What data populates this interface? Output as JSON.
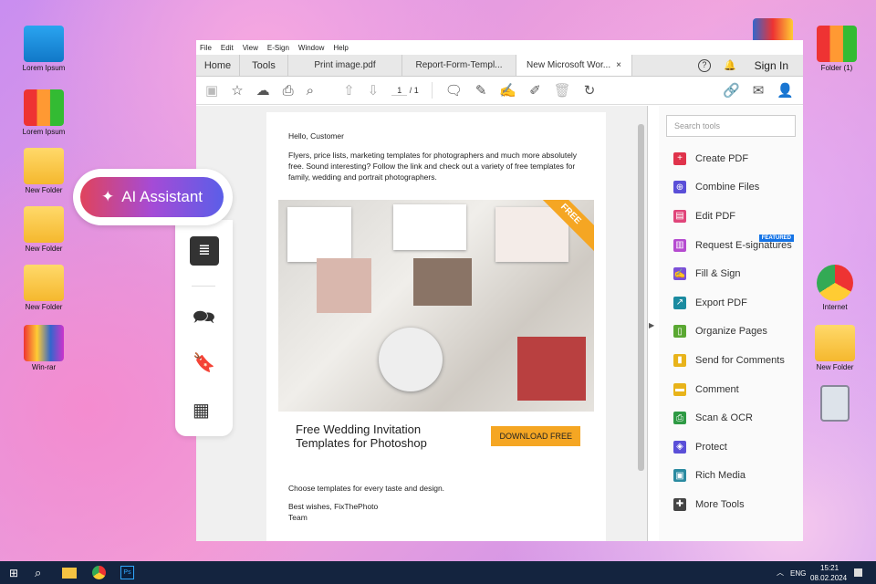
{
  "desktop": {
    "left_icons": [
      "Lorem Ipsum",
      "Lorem Ipsum",
      "New Folder",
      "New Folder",
      "New Folder",
      "Win-rar"
    ],
    "right_icons": [
      "Folder (1)",
      "Internet",
      "New Folder"
    ]
  },
  "menu": [
    "File",
    "Edit",
    "View",
    "E-Sign",
    "Window",
    "Help"
  ],
  "tabs": {
    "home": "Home",
    "tools": "Tools",
    "docs": [
      "Print image.pdf",
      "Report-Form-Templ...",
      "New Microsoft Wor..."
    ],
    "close": "×",
    "sign_in": "Sign In"
  },
  "toolbar": {
    "page_current": "1",
    "page_total": "/ 1"
  },
  "document": {
    "greeting": "Hello, Customer",
    "intro": "Flyers, price lists, marketing templates for photographers and much more absolutely free. Sound interesting? Follow the link and check out a variety of free templates for family, wedding and portrait photographers.",
    "ribbon": "FREE",
    "banner_title": "Free Wedding Invitation Templates for Photoshop",
    "download": "DOWNLOAD FREE",
    "choose": "Choose templates for every taste and design.",
    "wishes": "Best wishes, FixThePhoto",
    "team": "Team"
  },
  "pane": {
    "search_placeholder": "Search tools",
    "featured": "FEATURED",
    "items": [
      {
        "label": "Create PDF",
        "color": "#e0334b"
      },
      {
        "label": "Combine Files",
        "color": "#5a4fd8"
      },
      {
        "label": "Edit PDF",
        "color": "#e0457a"
      },
      {
        "label": "Request E-signatures",
        "color": "#b54bd0"
      },
      {
        "label": "Fill & Sign",
        "color": "#7b4fd8"
      },
      {
        "label": "Export PDF",
        "color": "#1b8ba0"
      },
      {
        "label": "Organize Pages",
        "color": "#5aa832"
      },
      {
        "label": "Send for Comments",
        "color": "#e8b31a"
      },
      {
        "label": "Comment",
        "color": "#e8b31a"
      },
      {
        "label": "Scan & OCR",
        "color": "#2e9a44"
      },
      {
        "label": "Protect",
        "color": "#5a4fd8"
      },
      {
        "label": "Rich Media",
        "color": "#2a8aa0"
      },
      {
        "label": "More Tools",
        "color": "#444444"
      }
    ]
  },
  "ai": {
    "label": "AI Assistant"
  },
  "taskbar": {
    "lang": "ENG",
    "time": "15:21",
    "date": "08.02.2024"
  }
}
